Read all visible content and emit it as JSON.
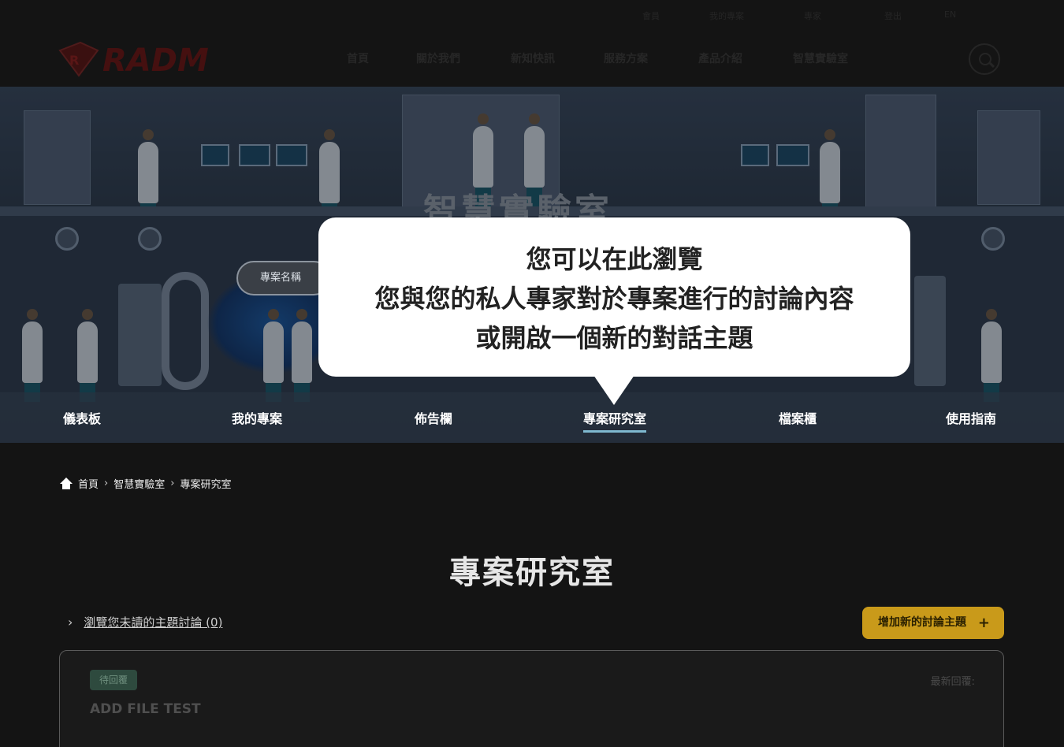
{
  "header": {
    "logo_text": "RADM",
    "util_links": [
      "會員",
      "我的專案",
      "專家",
      "登出",
      "EN"
    ],
    "nav": [
      "首頁",
      "關於我們",
      "新知快訊",
      "服務方案",
      "產品介紹",
      "智慧實驗室"
    ]
  },
  "hero": {
    "title": "智慧實驗室",
    "project_pill": "專案名稱"
  },
  "tabs": [
    {
      "label": "儀表板"
    },
    {
      "label": "我的專案"
    },
    {
      "label": "佈告欄"
    },
    {
      "label": "專案研究室"
    },
    {
      "label": "檔案櫃"
    },
    {
      "label": "使用指南"
    }
  ],
  "tooltip": {
    "line1": "您可以在此瀏覽",
    "line2": "您與您的私人專家對於專案進行的討論內容",
    "line3": "或開啟一個新的對話主題"
  },
  "breadcrumb": [
    "首頁",
    "智慧實驗室",
    "專案研究室"
  ],
  "page_title": "專案研究室",
  "unread_link": "瀏覽您未讀的主題討論 (0)",
  "add_topic_button": "增加新的討論主題",
  "add_topic_plus": "+",
  "topic_card": {
    "badge": "待回覆",
    "latest_reply_label": "最新回覆:",
    "title": "ADD FILE TEST"
  },
  "colors": {
    "accent_gold": "#c99a1a",
    "active_tab_underline": "#7fb8cf",
    "badge_green": "#2e4a3e"
  }
}
